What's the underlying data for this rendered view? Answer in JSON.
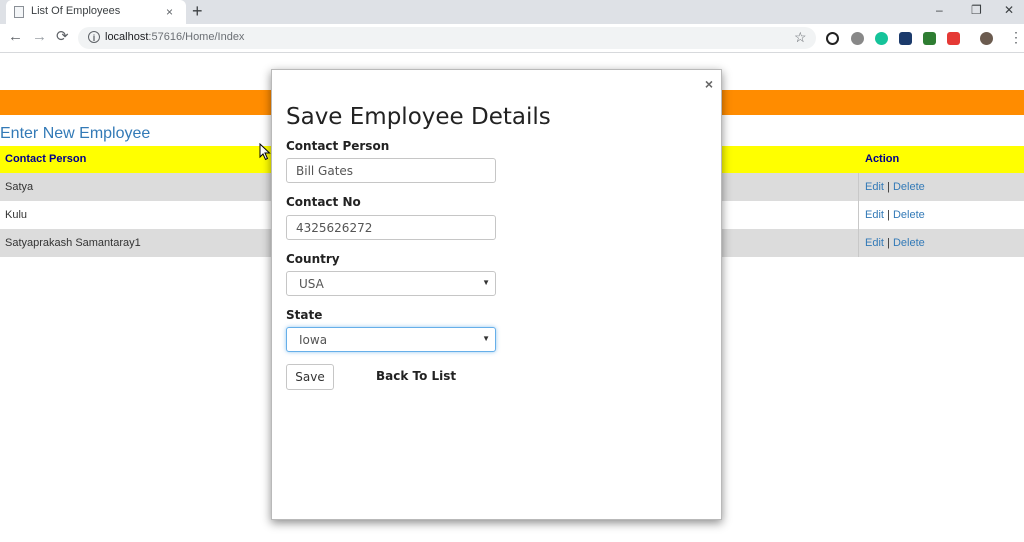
{
  "browser": {
    "tab_title": "List Of Employees",
    "tab_close": "×",
    "new_tab": "+",
    "url_host": "localhost",
    "url_path": ":57616/Home/Index",
    "window_controls": [
      "–",
      "❐",
      "✕"
    ],
    "nav": {
      "back": "←",
      "forward": "→",
      "reload": "⟳",
      "info": "i",
      "bookmark": "☆",
      "menu": "⋮"
    }
  },
  "page": {
    "enter_link": "Enter New Employee",
    "table": {
      "headers": [
        "Contact Person",
        "Action"
      ],
      "rows": [
        {
          "name": "Satya",
          "edit": "Edit",
          "sep": "|",
          "delete": "Delete"
        },
        {
          "name": "Kulu",
          "edit": "Edit",
          "sep": "|",
          "delete": "Delete"
        },
        {
          "name": "Satyaprakash Samantaray1",
          "edit": "Edit",
          "sep": "|",
          "delete": "Delete"
        }
      ]
    }
  },
  "modal": {
    "close": "×",
    "title": "Save Employee Details",
    "fields": {
      "contact_person": {
        "label": "Contact Person",
        "value": "Bill Gates"
      },
      "contact_no": {
        "label": "Contact No",
        "value": "4325626272"
      },
      "country": {
        "label": "Country",
        "value": "USA",
        "arrow": "▼"
      },
      "state": {
        "label": "State",
        "value": "Iowa",
        "arrow": "▼"
      }
    },
    "save_label": "Save",
    "back_label": "Back To List"
  },
  "colors": {
    "orange_bar": "#ff8c00",
    "header_bg": "#ffff00",
    "header_text": "#00008b",
    "link": "#337ab7",
    "row_alt": "#dcdcdc"
  }
}
